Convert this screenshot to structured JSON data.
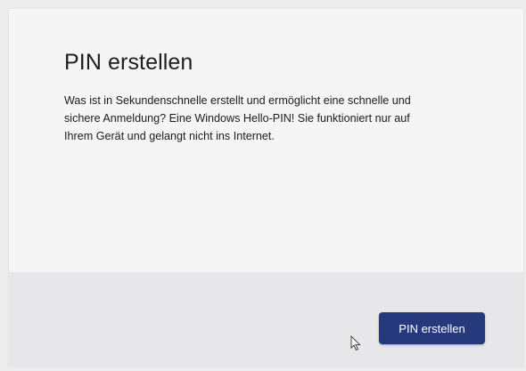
{
  "dialog": {
    "title": "PIN erstellen",
    "body_lines": [
      "Was ist in Sekundenschnelle erstellt und ermöglicht eine schnelle und",
      "sichere Anmeldung? Eine Windows Hello-PIN! Sie funktioniert nur auf",
      "Ihrem Gerät und gelangt nicht ins Internet."
    ],
    "primary_button_label": "PIN erstellen"
  },
  "icons": {
    "cursor": "mouse-pointer-icon"
  },
  "colors": {
    "primary_button": "#25397c",
    "dialog_background": "#f5f5f6",
    "footer_background": "#e7e7e9"
  }
}
